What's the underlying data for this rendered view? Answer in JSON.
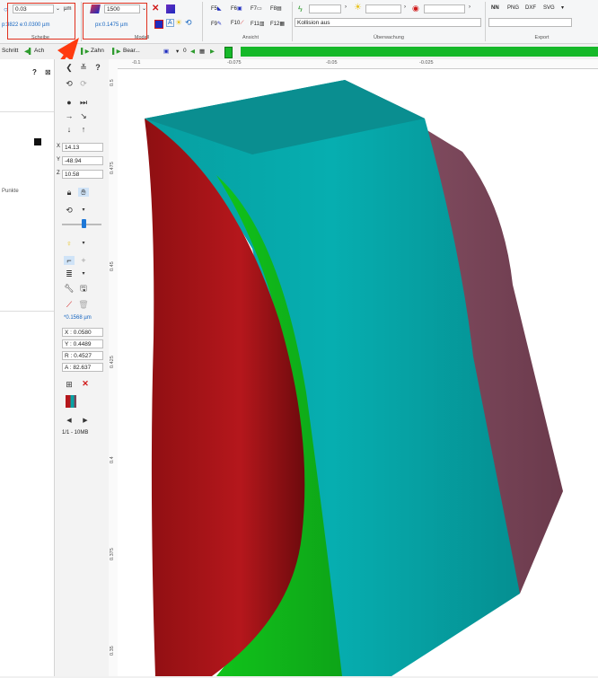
{
  "ribbon": {
    "scheibe": {
      "tolerance_value": "0.03",
      "tolerance_unit": "µm",
      "info_text": "p:3822 e:0.0300 µm",
      "label": "Scheibe"
    },
    "modell": {
      "count_value": "1500",
      "px_text": "px:0.1475 µm",
      "label": "Modell"
    },
    "ansicht": {
      "f5": "F5",
      "f6": "F6",
      "f7": "F7",
      "f8": "F8",
      "f9": "F9",
      "f10": "F10",
      "f11": "F11",
      "f12": "F12",
      "label": "Ansicht"
    },
    "ueberwachung": {
      "status_text": "Kollision aus",
      "label": "Überwachung"
    },
    "export": {
      "png": "PNG",
      "dxf": "DXF",
      "svg": "SVG",
      "label": "Export"
    }
  },
  "toolbar2": {
    "schritt": "Schritt",
    "achse_label": "Ach",
    "zahn": "Zahn",
    "bear": "Bear...",
    "counter": "0"
  },
  "leftpanel": {
    "question": "?",
    "punkte": "Punkte"
  },
  "tools": {
    "x_value": "14.13",
    "y_value": "-48.94",
    "z_value": "10.58",
    "dist_text": "*0.1568 µm",
    "x_readout": "X : 0.0580",
    "y_readout": "Y : 0.4489",
    "r_readout": "R : 0.4527",
    "a_readout": "A : 82.637",
    "page_info": "1/1 - 10MB"
  },
  "ruler": {
    "top_ticks": [
      "-0.1",
      "-0.075",
      "-0.05",
      "-0.025"
    ],
    "left_ticks": [
      "0.5",
      "0.475",
      "0.45",
      "0.425",
      "0.4",
      "0.375",
      "0.35"
    ]
  },
  "colors": {
    "red_face": "#a8141a",
    "green_face": "#12b51c",
    "cyan_face": "#06a4a6",
    "mauve_face": "#7a4658",
    "annotation": "#e0301e"
  }
}
